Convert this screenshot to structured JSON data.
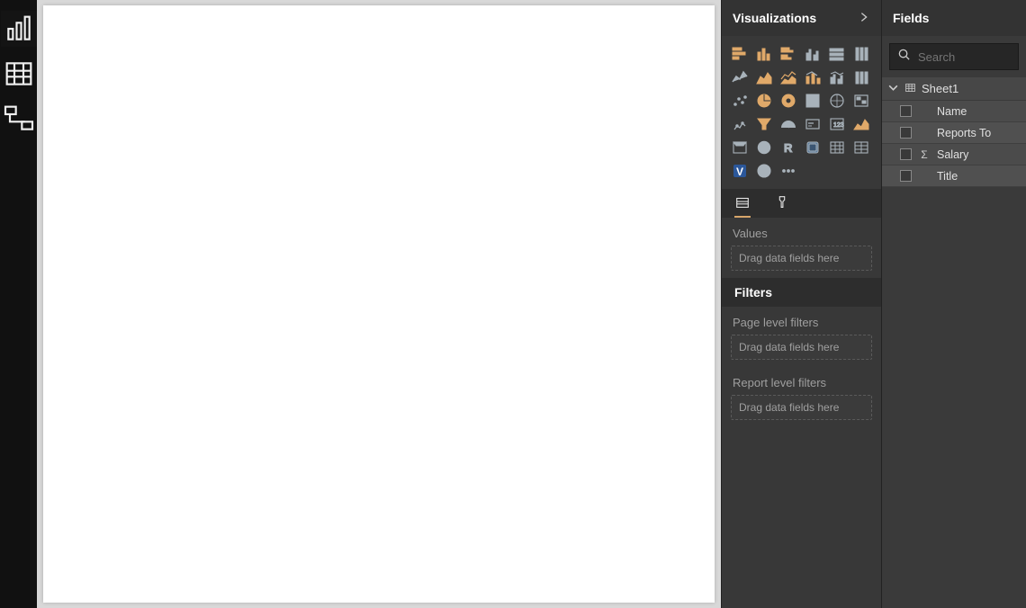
{
  "nav": {
    "items": [
      {
        "name": "report-view-icon"
      },
      {
        "name": "data-view-icon"
      },
      {
        "name": "model-view-icon"
      }
    ]
  },
  "visualizations": {
    "title": "Visualizations",
    "gallery": [
      "stacked-bar-chart-icon",
      "stacked-column-chart-icon",
      "clustered-bar-chart-icon",
      "clustered-column-chart-icon",
      "hundred-stacked-bar-icon",
      "hundred-stacked-column-icon",
      "line-chart-icon",
      "area-chart-icon",
      "stacked-area-chart-icon",
      "line-stacked-column-icon",
      "line-clustered-column-icon",
      "ribbon-chart-icon",
      "waterfall-chart-icon",
      "scatter-chart-icon",
      "pie-chart-icon",
      "donut-chart-icon",
      "treemap-icon",
      "map-icon",
      "filled-map-icon",
      "funnel-icon",
      "gauge-icon",
      "card-icon",
      "multi-row-card-icon",
      "kpi-icon",
      "slicer-icon",
      "table-visual-icon",
      "matrix-icon",
      "r-visual-icon",
      "python-visual-icon",
      "arcgis-map-icon",
      "visio-visual-icon",
      "globe-icon",
      "ellipsis-icon"
    ]
  },
  "fields_section": {
    "values_label": "Values",
    "drop_placeholder": "Drag data fields here"
  },
  "filters": {
    "title": "Filters",
    "page_level_label": "Page level filters",
    "report_level_label": "Report level filters",
    "drop_placeholder": "Drag data fields here"
  },
  "fields_panel": {
    "title": "Fields",
    "search_placeholder": "Search",
    "table": {
      "name": "Sheet1",
      "fields": [
        {
          "label": "Name",
          "is_measure": false
        },
        {
          "label": "Reports To",
          "is_measure": false
        },
        {
          "label": "Salary",
          "is_measure": true
        },
        {
          "label": "Title",
          "is_measure": false
        }
      ]
    }
  }
}
